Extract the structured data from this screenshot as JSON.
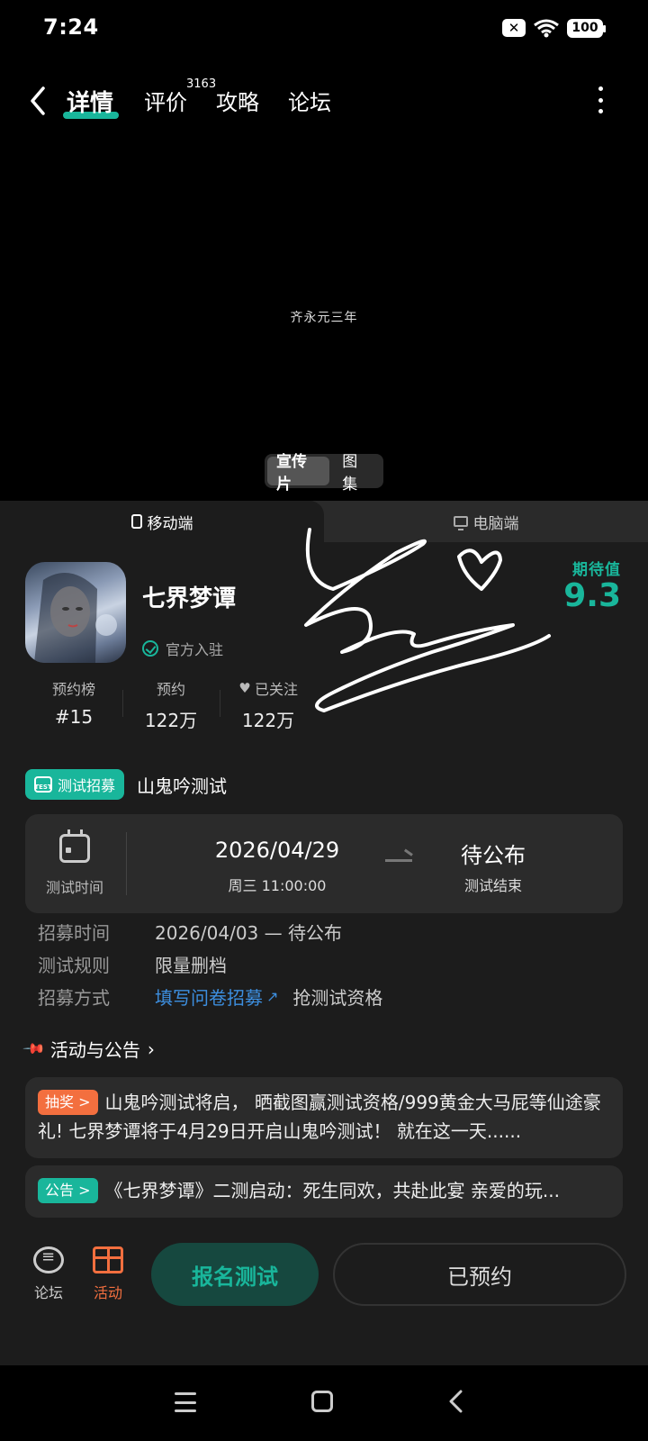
{
  "status": {
    "time": "7:24",
    "battery": "100"
  },
  "nav": {
    "tabs": [
      {
        "label": "详情"
      },
      {
        "label": "评价"
      },
      {
        "label": "攻略"
      },
      {
        "label": "论坛"
      }
    ],
    "review_count": "3163"
  },
  "video": {
    "caption": "齐永元三年",
    "media_options": [
      "宣传片",
      "图集"
    ]
  },
  "platform_tabs": [
    "移动端",
    "电脑端"
  ],
  "game": {
    "title": "七界梦谭",
    "official_label": "官方入驻",
    "expect_label": "期待值",
    "expect_value": "9.3"
  },
  "stats": [
    {
      "label": "预约榜",
      "value": "#15"
    },
    {
      "label": "预约",
      "value": "122万"
    },
    {
      "label": "已关注",
      "value": "122万"
    }
  ],
  "recruit": {
    "badge": "测试招募",
    "badge_icon_text": "TEST",
    "name": "山鬼吟测试"
  },
  "test_time": {
    "label": "测试时间",
    "start_date": "2026/04/29",
    "start_sub": "周三  11:00:00",
    "end_date": "待公布",
    "end_sub": "测试结束"
  },
  "info": [
    {
      "label": "招募时间",
      "value": "2026/04/03 — 待公布"
    },
    {
      "label": "测试规则",
      "value": "限量删档"
    },
    {
      "label": "招募方式",
      "link": "填写问卷招募",
      "value": "抢测试资格"
    }
  ],
  "section_title": "活动与公告",
  "notices": [
    {
      "badge": "抽奖 >",
      "text": "山鬼吟测试将启， 晒截图赢测试资格/999黄金大马屁等仙途豪礼! 七界梦谭将于4月29日开启山鬼吟测试！ 就在这一天......"
    },
    {
      "badge": "公告 >",
      "text": "《七界梦谭》二测启动：死生同欢，共赴此宴 亲爱的玩..."
    }
  ],
  "bottom_bar": {
    "forum_label": "论坛",
    "activity_label": "活动",
    "signup_label": "报名测试",
    "reserved_label": "已预约"
  },
  "colors": {
    "accent": "#19b69b",
    "orange": "#f36f3f",
    "link": "#3d8fe0"
  }
}
